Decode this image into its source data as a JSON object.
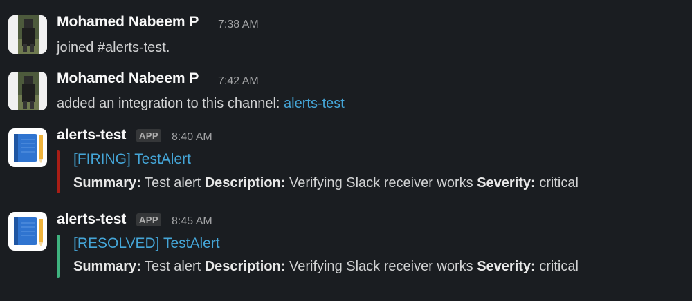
{
  "messages": [
    {
      "user": "Mohamed Nabeem P",
      "time": "7:38 AM",
      "text": "joined #alerts-test."
    },
    {
      "user": "Mohamed Nabeem P",
      "time": "7:42 AM",
      "text_prefix": "added an integration to this channel: ",
      "link": "alerts-test"
    },
    {
      "user": "alerts-test",
      "badge": "APP",
      "time": "8:40 AM",
      "attachment": {
        "color": "#a91e16",
        "title": "[FIRING] TestAlert",
        "summary_label": "Summary:",
        "summary_value": "Test alert",
        "description_label": "Description:",
        "description_value": "Verifying Slack receiver works",
        "severity_label": "Severity:",
        "severity_value": "critical"
      }
    },
    {
      "user": "alerts-test",
      "badge": "APP",
      "time": "8:45 AM",
      "attachment": {
        "color": "#3fb37f",
        "title": "[RESOLVED] TestAlert",
        "summary_label": "Summary:",
        "summary_value": "Test alert",
        "description_label": "Description:",
        "description_value": "Verifying Slack receiver works",
        "severity_label": "Severity:",
        "severity_value": "critical"
      }
    }
  ]
}
